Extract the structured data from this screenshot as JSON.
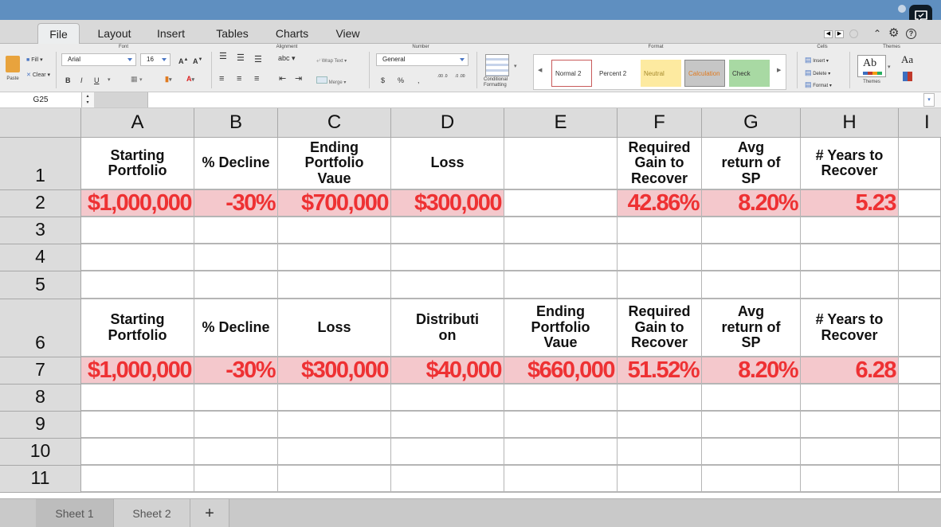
{
  "colors": {
    "titlebar": "#5f8fc0",
    "value_fill": "#f4c8cc",
    "value_text": "#ee3133",
    "header_fill": "#dcdcdc"
  },
  "tabs": [
    "File",
    "Layout",
    "Insert",
    "Tables",
    "Charts",
    "View"
  ],
  "active_tab": "File",
  "ribbon": {
    "groups": {
      "font": "Font",
      "alignment": "Alignment",
      "number": "Number",
      "format": "Format",
      "cells": "Cells",
      "themes": "Themes"
    },
    "paste": "Paste",
    "fill": "Fill",
    "clear": "Clear",
    "font_name": "Arial",
    "font_size": "16",
    "bold": "B",
    "italic": "I",
    "underline": "U",
    "abc": "abc",
    "wrap_text": "Wrap Text",
    "merge": "Merge",
    "number_format": "General",
    "currency": "$",
    "percent": "%",
    "comma": ",",
    "dec_inc": ".00 .0",
    "dec_dec": ".0 .00",
    "conditional_formatting": "Conditional Formatting",
    "styles": [
      "Normal 2",
      "Percent 2",
      "Neutral",
      "Calculation",
      "Check"
    ],
    "insert": "Insert",
    "delete": "Delete",
    "format": "Format",
    "themes_sample": "Ab",
    "themes_label": "Themes",
    "aa": "Aa"
  },
  "name_box": "G25",
  "columns": [
    "A",
    "B",
    "C",
    "D",
    "E",
    "F",
    "G",
    "H",
    "I"
  ],
  "rows": [
    "1",
    "2",
    "3",
    "4",
    "5",
    "6",
    "7",
    "8",
    "9",
    "10",
    "11"
  ],
  "cells": {
    "r1": [
      "Starting\nPortfolio",
      "% Decline",
      "Ending\nPortfolio\nVaue",
      "Loss",
      "",
      "Required\nGain to\nRecover",
      "Avg\nreturn of\nSP",
      "# Years to\nRecover"
    ],
    "r2": [
      "$1,000,000",
      "-30%",
      "$700,000",
      "$300,000",
      "",
      "42.86%",
      "8.20%",
      "5.23"
    ],
    "r6": [
      "Starting\nPortfolio",
      "% Decline",
      "Loss",
      "Distributi\non",
      "Ending\nPortfolio\nVaue",
      "Required\nGain to\nRecover",
      "Avg\nreturn of\nSP",
      "# Years to\nRecover"
    ],
    "r7": [
      "$1,000,000",
      "-30%",
      "$300,000",
      "$40,000",
      "$660,000",
      "51.52%",
      "8.20%",
      "6.28"
    ]
  },
  "sheets": [
    "Sheet 1",
    "Sheet 2"
  ],
  "add_sheet": "+"
}
